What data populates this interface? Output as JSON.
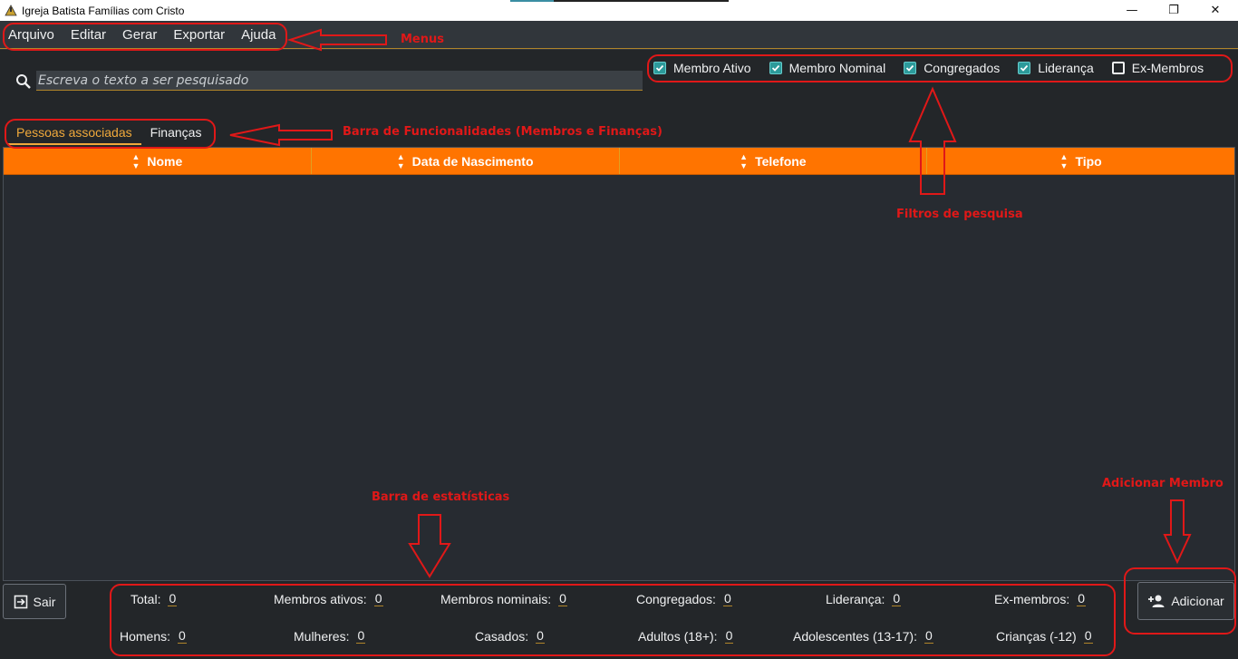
{
  "window": {
    "title": "Igreja Batista Famílias com Cristo",
    "minimize": "—",
    "restore": "❐",
    "close": "✕"
  },
  "menu": [
    "Arquivo",
    "Editar",
    "Gerar",
    "Exportar",
    "Ajuda"
  ],
  "search": {
    "placeholder": "Escreva o texto a ser pesquisado",
    "value": ""
  },
  "filters": [
    {
      "label": "Membro Ativo",
      "checked": true
    },
    {
      "label": "Membro Nominal",
      "checked": true
    },
    {
      "label": "Congregados",
      "checked": true
    },
    {
      "label": "Liderança",
      "checked": true
    },
    {
      "label": "Ex-Membros",
      "checked": false
    }
  ],
  "tabs": [
    {
      "label": "Pessoas associadas",
      "active": true
    },
    {
      "label": "Finanças",
      "active": false
    }
  ],
  "table": {
    "columns": [
      "Nome",
      "Data de Nascimento",
      "Telefone",
      "Tipo"
    ],
    "rows": []
  },
  "buttons": {
    "exit": "Sair",
    "add": "Adicionar"
  },
  "stats": {
    "total": {
      "label": "Total:",
      "value": "0"
    },
    "ativos": {
      "label": "Membros ativos:",
      "value": "0"
    },
    "nominais": {
      "label": "Membros nominais:",
      "value": "0"
    },
    "congregados": {
      "label": "Congregados:",
      "value": "0"
    },
    "lideranca": {
      "label": "Liderança:",
      "value": "0"
    },
    "exmembros": {
      "label": "Ex-membros:",
      "value": "0"
    },
    "homens": {
      "label": "Homens:",
      "value": "0"
    },
    "mulheres": {
      "label": "Mulheres:",
      "value": "0"
    },
    "casados": {
      "label": "Casados:",
      "value": "0"
    },
    "adultos": {
      "label": "Adultos (18+):",
      "value": "0"
    },
    "adolescentes": {
      "label": "Adolescentes (13-17):",
      "value": "0"
    },
    "criancas": {
      "label": "Crianças (-12)",
      "value": "0"
    }
  },
  "annotations": {
    "menus": "Menus",
    "funcionalidades": "Barra de Funcionalidades (Membros e Finanças)",
    "filtros": "Filtros de pesquisa",
    "estatisticas": "Barra de estatísticas",
    "adicionar": "Adicionar Membro"
  },
  "colors": {
    "accent": "#ff7400",
    "annotation": "#e01818",
    "tab_active": "#f0a93b"
  }
}
